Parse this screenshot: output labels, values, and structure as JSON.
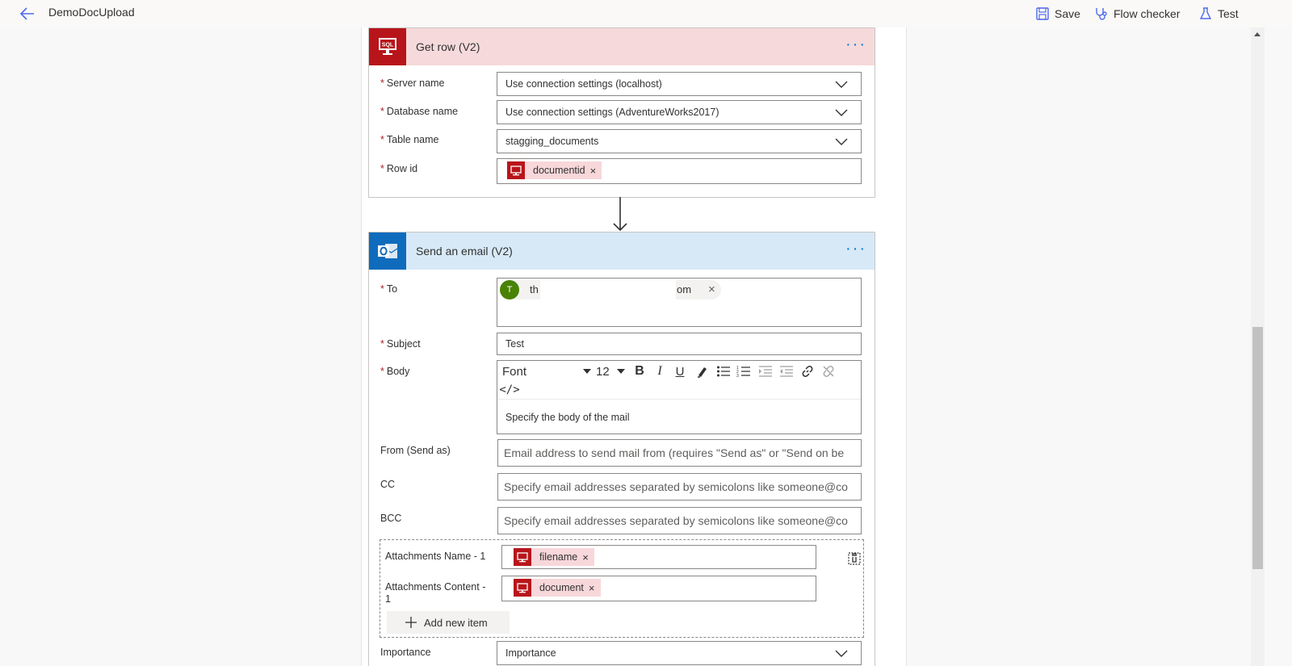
{
  "header": {
    "title": "DemoDocUpload",
    "save_label": "Save",
    "flow_checker_label": "Flow checker",
    "test_label": "Test"
  },
  "get_row": {
    "title": "Get row (V2)",
    "icon_text": "SQL",
    "more": "···",
    "fields": {
      "server_name": {
        "label": "Server name",
        "value": "Use connection settings (localhost)"
      },
      "database_name": {
        "label": "Database name",
        "value": "Use connection settings (AdventureWorks2017)"
      },
      "table_name": {
        "label": "Table name",
        "value": "stagging_documents"
      },
      "row_id": {
        "label": "Row id",
        "token": "documentid"
      }
    }
  },
  "send_email": {
    "title": "Send an email (V2)",
    "more": "···",
    "to": {
      "label": "To",
      "avatar": "T",
      "recipient_start": "th",
      "recipient_end": "om"
    },
    "subject": {
      "label": "Subject",
      "value": "Test"
    },
    "body": {
      "label": "Body",
      "font": "Font",
      "size": "12",
      "bold": "B",
      "italic": "I",
      "underline": "U",
      "code": "</>",
      "placeholder": "Specify the body of the mail"
    },
    "from": {
      "label": "From (Send as)",
      "placeholder": "Email address to send mail from (requires \"Send as\" or \"Send on be"
    },
    "cc": {
      "label": "CC",
      "placeholder": "Specify email addresses separated by semicolons like someone@co"
    },
    "bcc": {
      "label": "BCC",
      "placeholder": "Specify email addresses separated by semicolons like someone@co"
    },
    "attachments_name": {
      "label": "Attachments Name - 1",
      "token": "filename"
    },
    "attachments_content": {
      "label_line1": "Attachments Content -",
      "label_line2": "1",
      "token": "document"
    },
    "add_new_item": "Add new item",
    "importance": {
      "label": "Importance",
      "value": "Importance"
    }
  },
  "colors": {
    "sql_red": "#b8151b",
    "sql_header": "#f6dadb",
    "outlook_blue": "#0f6cbd",
    "email_header": "#d7e9f7",
    "accent": "#0078d4"
  }
}
